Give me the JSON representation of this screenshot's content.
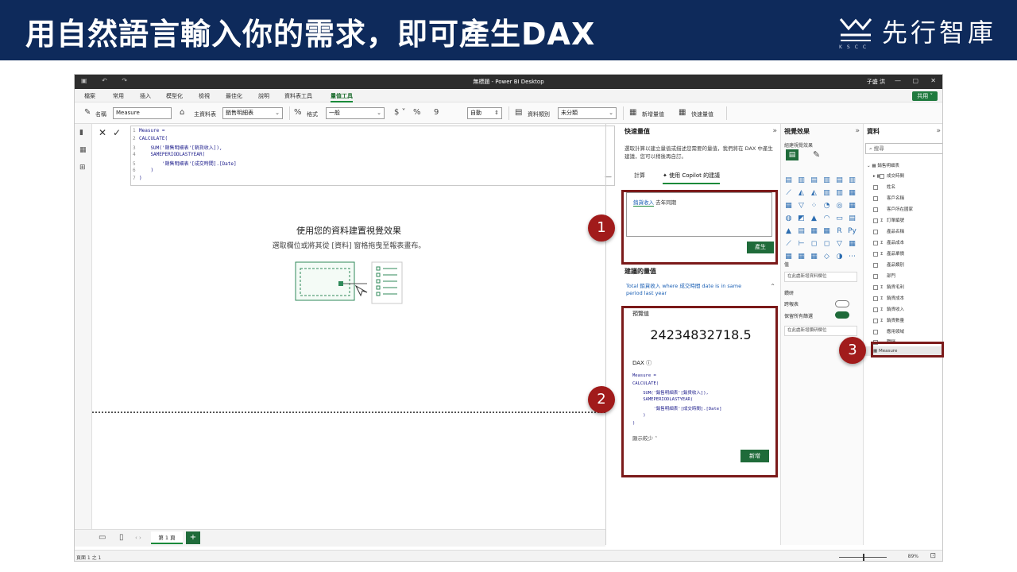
{
  "banner": {
    "title": "用自然語言輸入你的需求，即可產生DAX",
    "logo_text": "先行智庫",
    "logo_sub": "KSCC"
  },
  "window": {
    "title": "無標題 - Power BI Desktop",
    "user": "子盛 洪",
    "min": "—",
    "max": "▢",
    "close": "✕",
    "quick_icons": "▣ ↶ ↷"
  },
  "menu": {
    "items": [
      "檔案",
      "常用",
      "插入",
      "模型化",
      "檢視",
      "最佳化",
      "說明",
      "資料表工具",
      "量值工具"
    ],
    "active_index": 8,
    "share_label": "共用 ˅"
  },
  "ribbon": {
    "name_label": "名稱",
    "name_value": "Measure",
    "home_table_label": "主資料表",
    "home_table_value": "銷售明細表",
    "format_label": "格式",
    "format_value": "一般",
    "currency": "$ ˅",
    "percent": "%",
    "comma": "9",
    "decimals_value": "自動",
    "category_label": "資料類別",
    "category_value": "未分類",
    "new_measure": "新增量值",
    "quick_measure": "快速量值"
  },
  "formula": {
    "lines": [
      {
        "n": "1",
        "t": "Measure ="
      },
      {
        "n": "2",
        "t": "CALCULATE("
      },
      {
        "n": "3",
        "t": "    SUM('銷售明細表'[銷貨收入]),"
      },
      {
        "n": "4",
        "t": "    SAMEPERIODLASTYEAR("
      },
      {
        "n": "5",
        "t": "        '銷售明細表'[成交時間].[Date]"
      },
      {
        "n": "6",
        "t": "    )"
      },
      {
        "n": "7",
        "t": ")"
      }
    ]
  },
  "canvas": {
    "title": "使用您的資料建置視覺效果",
    "subtitle": "選取欄位或將其從 [資料] 窗格拖曳至報表畫布。"
  },
  "quick_measure": {
    "title": "快速量值",
    "desc": "選取計算以建立量值或描述您需要的量值，我們將在 DAX 中產生建議，您可以稍後再自訂。",
    "tab_calc": "計算",
    "tab_copilot": "使用 Copilot 的建議",
    "input_highlight": "銷貨收入",
    "input_rest": " 去年同期",
    "generate_label": "產生",
    "suggest_title": "建議的量值",
    "suggest_desc": "Total 銷貨收入 where 成交時間 date is in same period last year",
    "preview_label": "預覽值",
    "preview_value": "24234832718.5",
    "dax_label": "DAX ⓘ",
    "dax_lines": [
      "Measure =",
      "CALCULATE(",
      "    SUM('銷售明細表'[銷貨收入]),",
      "    SAMEPERIODLASTYEAR(",
      "        '銷售明細表'[成交時間].[Date]",
      "    )",
      ")"
    ],
    "show_less": "顯示較少 ˄",
    "add_label": "新增"
  },
  "viz": {
    "title": "視覺效果",
    "build_label": "組建視覺效果",
    "values_label": "值",
    "values_well": "在此處新增資料欄位",
    "drill_label": "鑽研",
    "cross_report": "跨報表",
    "keep_filters": "保留所有篩選",
    "drill_well": "在此處新增鑽研欄位"
  },
  "data": {
    "title": "資料",
    "search_placeholder": "⌕ 搜尋",
    "table_name": "銷售明細表",
    "fields": [
      {
        "name": "成交時間",
        "sig": "▸ ▦"
      },
      {
        "name": "姓名",
        "sig": ""
      },
      {
        "name": "客戶名稱",
        "sig": ""
      },
      {
        "name": "客戶所在國家",
        "sig": ""
      },
      {
        "name": "訂單編號",
        "sig": "Σ"
      },
      {
        "name": "產品名稱",
        "sig": ""
      },
      {
        "name": "產品成本",
        "sig": "Σ"
      },
      {
        "name": "產品單價",
        "sig": "Σ"
      },
      {
        "name": "產品類別",
        "sig": ""
      },
      {
        "name": "部門",
        "sig": ""
      },
      {
        "name": "銷貨毛利",
        "sig": "Σ"
      },
      {
        "name": "銷貨成本",
        "sig": "Σ"
      },
      {
        "name": "銷貨收入",
        "sig": "Σ"
      },
      {
        "name": "銷貨數量",
        "sig": "Σ"
      },
      {
        "name": "應用領域",
        "sig": ""
      },
      {
        "name": "職稱",
        "sig": ""
      }
    ],
    "measure_name": "Measure"
  },
  "status": {
    "page_tab": "第 1 頁",
    "add_page": "+",
    "page_info": "頁面 1 之 1",
    "zoom": "89%"
  },
  "callouts": [
    "1",
    "2",
    "3"
  ]
}
